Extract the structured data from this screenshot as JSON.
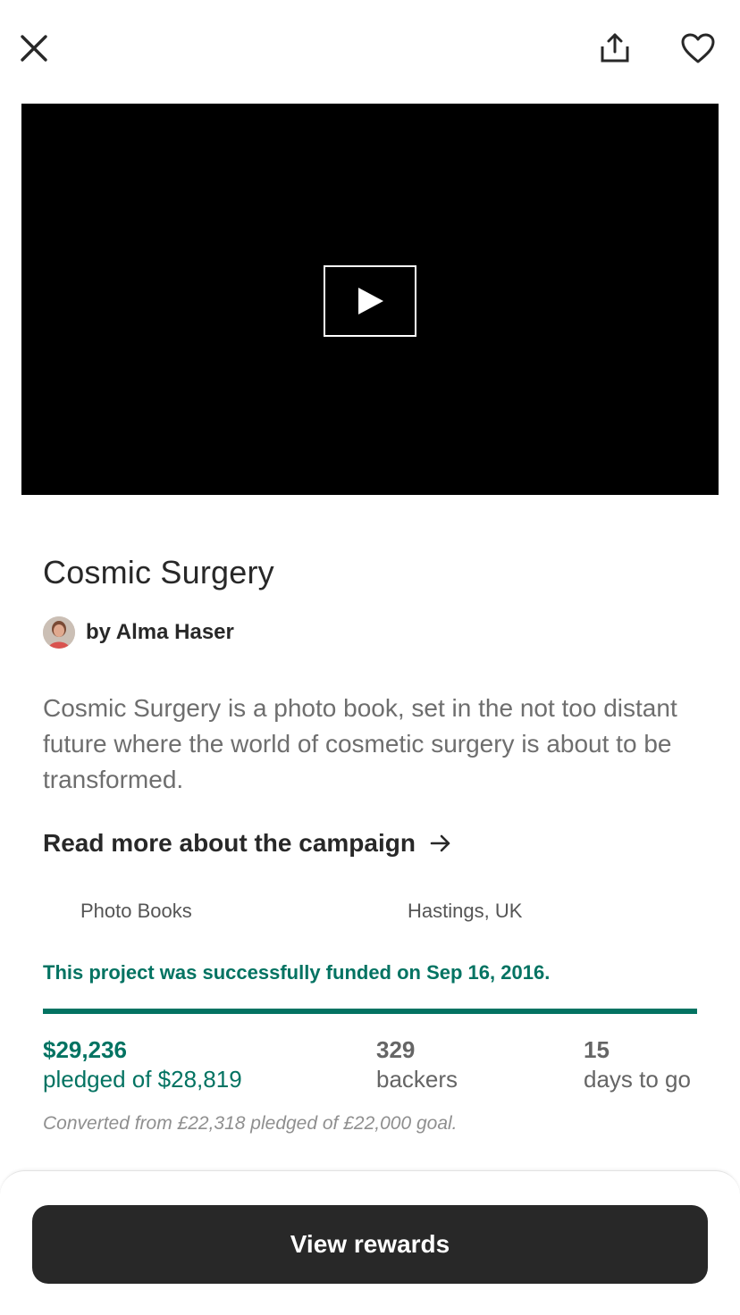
{
  "header": {
    "close_icon": "close-icon",
    "share_icon": "share-icon",
    "favorite_icon": "heart-icon"
  },
  "video": {
    "play_icon": "play-icon",
    "background": "#000000"
  },
  "project": {
    "title": "Cosmic Surgery",
    "creator_label": "by Alma Haser",
    "blurb": "Cosmic Surgery is a photo book, set in the not too distant future where the world of cosmetic surgery is about to be transformed.",
    "read_more_label": "Read more about the campaign",
    "category": "Photo Books",
    "location": "Hastings, UK"
  },
  "funding": {
    "status_text": "This project was successfully funded on Sep 16, 2016.",
    "progress_fraction": 1.0,
    "pledged_value": "$29,236",
    "pledged_label": "pledged of $28,819",
    "backers_value": "329",
    "backers_label": "backers",
    "days_value": "15",
    "days_label": "days to go",
    "converted_note": "Converted from £22,318 pledged of £22,000 goal."
  },
  "footer": {
    "cta_label": "View rewards"
  },
  "colors": {
    "accent_green": "#037362",
    "text_dark": "#282828",
    "text_muted": "#6e6e6e",
    "button_dark": "#282828"
  }
}
